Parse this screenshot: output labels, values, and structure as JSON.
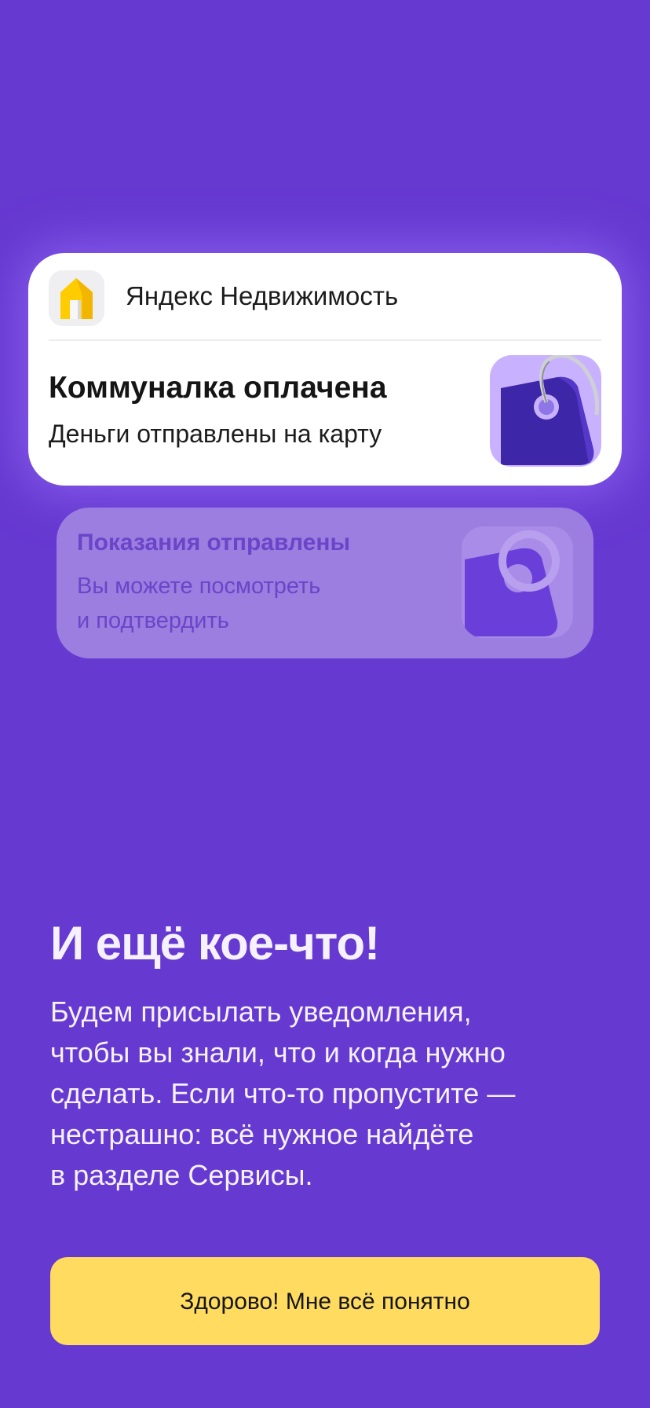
{
  "notification": {
    "app_name": "Яндекс Недвижимость",
    "app_icon": "yandex-realty-house-icon",
    "title": "Коммуналка оплачена",
    "text": "Деньги отправлены на карту",
    "image": "price-tag-icon"
  },
  "ghost_notification": {
    "title": "Показания отправлены",
    "text_line1": "Вы можете посмотреть",
    "text_line2": "и подтвердить",
    "image": "price-tag-icon"
  },
  "content": {
    "heading": "И ещё кое-что!",
    "body_lines": [
      "Будем присылать уведомления,",
      "чтобы вы знали, что и когда нужно",
      "сделать. Если что-то пропустите —",
      "нестрашно: всё нужное найдёте",
      "в разделе Сервисы."
    ]
  },
  "button": {
    "label": "Здорово! Мне всё понятно"
  },
  "colors": {
    "background": "#6639d1",
    "card": "#ffffff",
    "ghost_card": "#9b7ee0",
    "button": "#ffdc60",
    "icon_yellow": "#ffcc00"
  }
}
